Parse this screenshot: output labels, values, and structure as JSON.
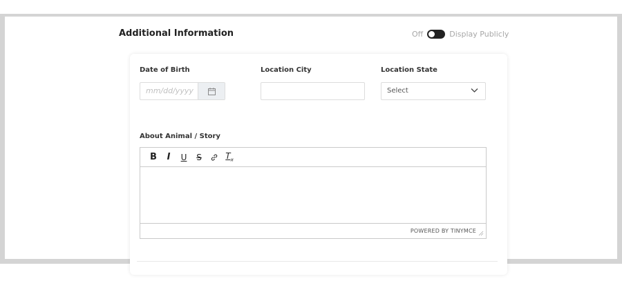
{
  "section": {
    "title": "Additional Information",
    "toggle_off_label": "Off",
    "toggle_label": "Display Publicly",
    "toggle_state": "off"
  },
  "fields": {
    "dob_label": "Date of Birth",
    "dob_placeholder": "mm/dd/yyyy",
    "city_label": "Location City",
    "city_value": "",
    "state_label": "Location State",
    "state_selected": "Select"
  },
  "story": {
    "label": "About Animal / Story",
    "toolbar": [
      "B",
      "I",
      "U",
      "S",
      "link",
      "Tx"
    ],
    "powered_by": "POWERED BY TINYMCE"
  },
  "icons": {
    "calendar": "calendar-icon",
    "select_arrow": "chevron-down-icon",
    "resize": "resize-grip-icon"
  },
  "colors": {
    "toggle_track": "#222222",
    "frame": "#d4d4d4"
  }
}
